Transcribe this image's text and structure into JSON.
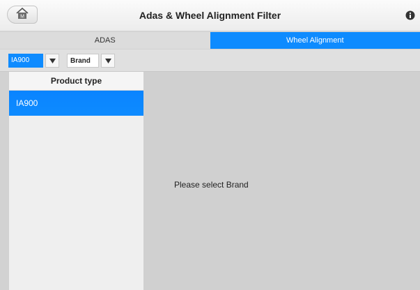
{
  "header": {
    "title": "Adas & Wheel Alignment Filter",
    "home_icon": "home-icon",
    "home_label": "M",
    "info_icon": "info-icon"
  },
  "tabs": [
    {
      "label": "ADAS",
      "active": false
    },
    {
      "label": "Wheel Alignment",
      "active": true
    }
  ],
  "filters": {
    "product": {
      "value": "IA900",
      "arrow_icon": "caret-down-icon"
    },
    "brand": {
      "value": "Brand",
      "arrow_icon": "caret-down-icon"
    }
  },
  "left_panel": {
    "header": "Product type",
    "items": [
      {
        "label": "IA900",
        "selected": true
      }
    ]
  },
  "right_panel": {
    "message": "Please select Brand"
  },
  "colors": {
    "accent": "#0e8bff",
    "panel_bg": "#efefef",
    "content_bg": "#d0d0d0"
  }
}
